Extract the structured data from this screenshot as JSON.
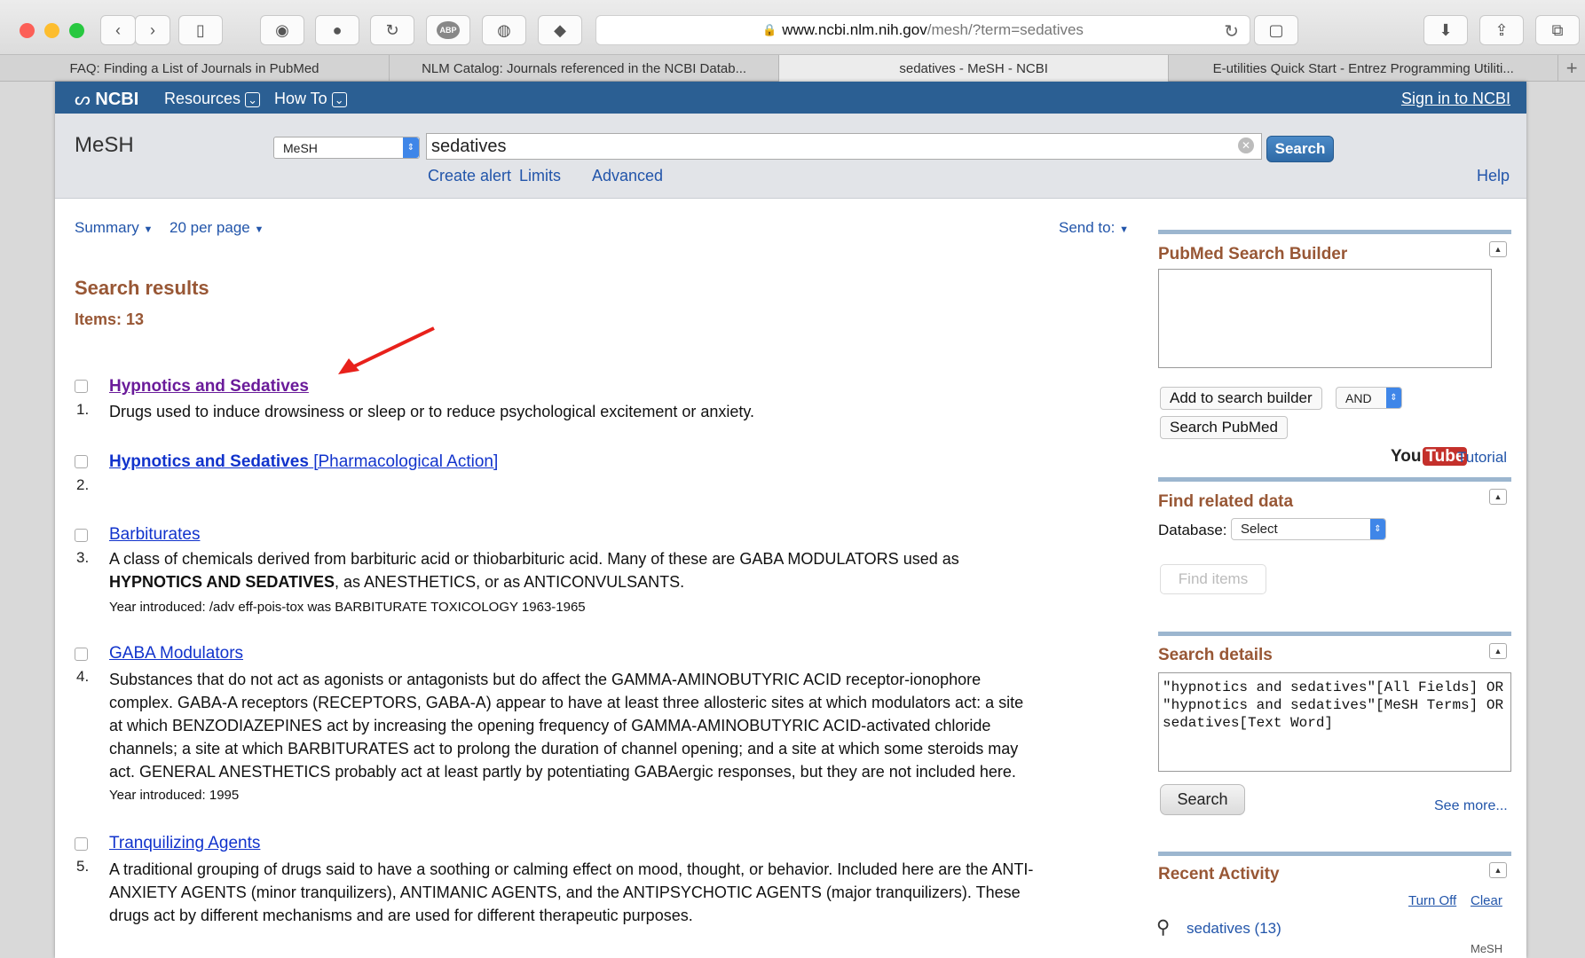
{
  "browser": {
    "url_domain": "www.ncbi.nlm.nih.gov",
    "url_path": "/mesh/?term=sedatives",
    "tabs": [
      {
        "label": "FAQ: Finding a List of Journals in PubMed",
        "active": false
      },
      {
        "label": "NLM Catalog: Journals referenced in the NCBI Datab...",
        "active": false
      },
      {
        "label": "sedatives - MeSH - NCBI",
        "active": true
      },
      {
        "label": "E-utilities Quick Start - Entrez Programming Utiliti...",
        "active": false
      }
    ],
    "new_tab": "+",
    "adblock_label": "ABP"
  },
  "ncbi_bar": {
    "logo": "NCBI",
    "resources": "Resources",
    "howto": "How To",
    "sign_in": "Sign in to NCBI"
  },
  "search": {
    "db_title": "MeSH",
    "db_selected": "MeSH",
    "term": "sedatives",
    "button": "Search",
    "links": {
      "create_alert": "Create alert",
      "limits": "Limits",
      "advanced": "Advanced",
      "help": "Help"
    }
  },
  "controls": {
    "summary": "Summary",
    "per_page": "20 per page",
    "send_to": "Send to:"
  },
  "results": {
    "heading": "Search results",
    "items": "Items: 13",
    "list": [
      {
        "num": "1.",
        "title": "Hypnotics and Sedatives",
        "desc": "Drugs used to induce drowsiness or sleep or to reduce psychological excitement or anxiety."
      },
      {
        "num": "2.",
        "title": "Hypnotics and Sedatives",
        "suffix": "[Pharmacological Action]"
      },
      {
        "num": "3.",
        "title": "Barbiturates",
        "desc_a": "A class of chemicals derived from barbituric acid or thiobarbituric acid. Many of these are GABA MODULATORS used as ",
        "desc_bold": "HYPNOTICS AND SEDATIVES",
        "desc_b": ", as ANESTHETICS, or as ANTICONVULSANTS.",
        "year": "Year introduced: /adv eff-pois-tox was BARBITURATE TOXICOLOGY 1963-1965"
      },
      {
        "num": "4.",
        "title": "GABA Modulators",
        "desc": "Substances that do not act as agonists or antagonists but do affect the GAMMA-AMINOBUTYRIC ACID receptor-ionophore complex. GABA-A receptors (RECEPTORS, GABA-A) appear to have at least three allosteric sites at which modulators act: a site at which BENZODIAZEPINES act by increasing the opening frequency of GAMMA-AMINOBUTYRIC ACID-activated chloride channels; a site at which BARBITURATES act to prolong the duration of channel opening; and a site at which some steroids may act. GENERAL ANESTHETICS probably act at least partly by potentiating GABAergic responses, but they are not included here.",
        "year": "Year introduced: 1995"
      },
      {
        "num": "5.",
        "title": "Tranquilizing Agents",
        "desc": "A traditional grouping of drugs said to have a soothing or calming effect on mood, thought, or behavior. Included here are the ANTI-ANXIETY AGENTS (minor tranquilizers), ANTIMANIC AGENTS, and the ANTIPSYCHOTIC AGENTS (major tranquilizers). These drugs act by different mechanisms and are used for different therapeutic purposes."
      }
    ]
  },
  "sidebar": {
    "builder": {
      "title": "PubMed Search Builder",
      "add": "Add to search builder",
      "operator": "AND",
      "search_pubmed": "Search PubMed",
      "yt_you": "You",
      "yt_tube": "Tube",
      "tutorial": "Tutorial"
    },
    "related": {
      "title": "Find related data",
      "db_label": "Database:",
      "db_value": "Select",
      "find": "Find items"
    },
    "details": {
      "title": "Search details",
      "query": "\"hypnotics and sedatives\"[All Fields] OR \"hypnotics and sedatives\"[MeSH Terms] OR sedatives[Text Word]",
      "search": "Search",
      "see_more": "See more..."
    },
    "recent": {
      "title": "Recent Activity",
      "turn_off": "Turn Off",
      "clear": "Clear",
      "item": "sedatives (13)",
      "db": "MeSH"
    }
  },
  "colors": {
    "ncbi_blue": "#2b5f93",
    "heading_brown": "#985735",
    "link_blue": "#1133cc",
    "visited_purple": "#6a1b9a",
    "annotation_red": "#e8211b"
  }
}
